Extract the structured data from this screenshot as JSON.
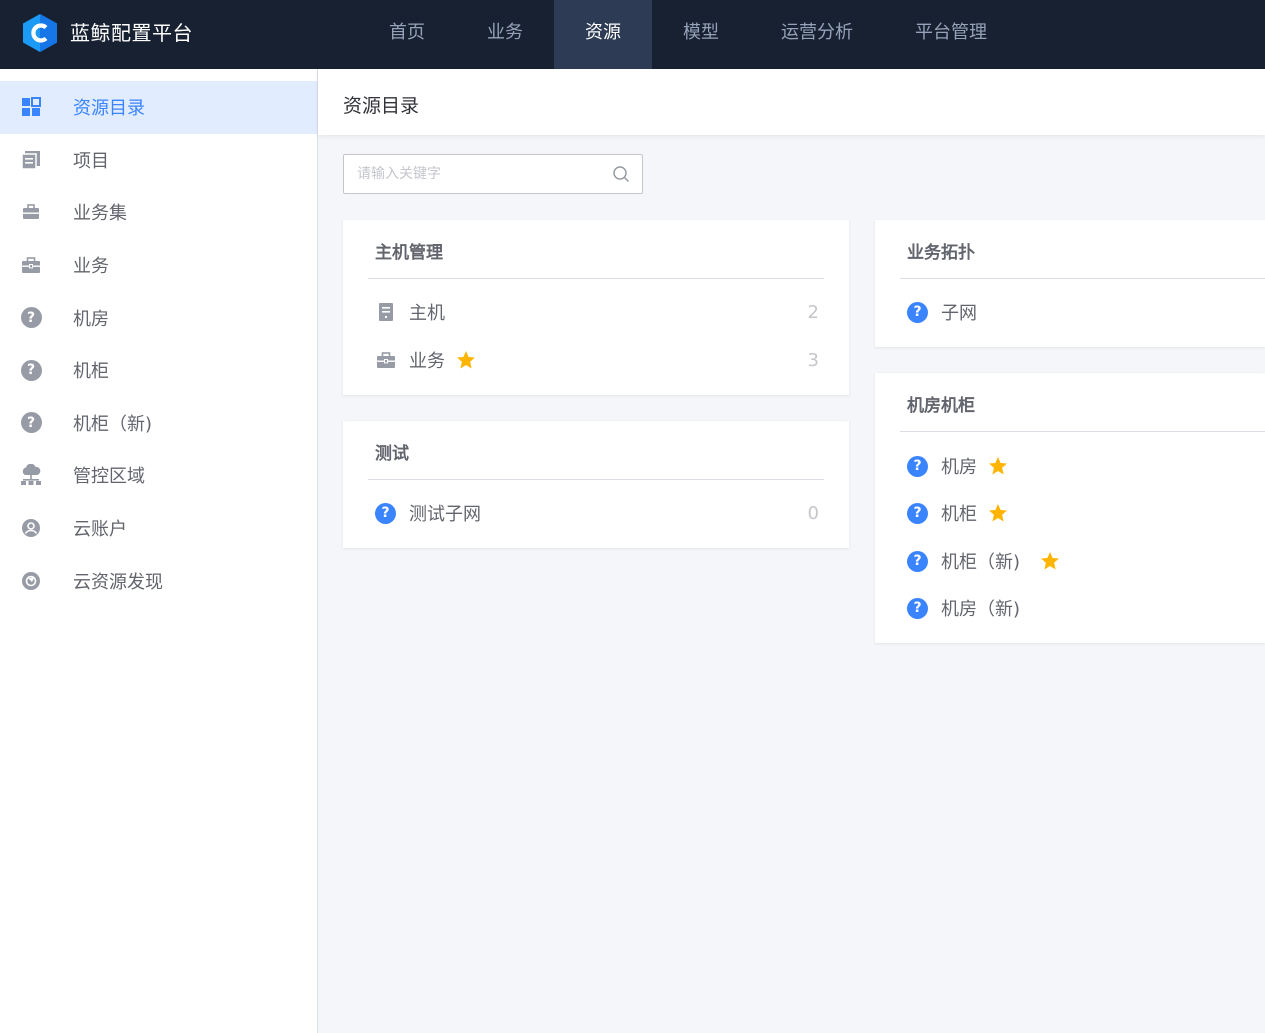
{
  "header": {
    "brand": "蓝鲸配置平台",
    "nav": [
      {
        "label": "首页",
        "active": false
      },
      {
        "label": "业务",
        "active": false
      },
      {
        "label": "资源",
        "active": true
      },
      {
        "label": "模型",
        "active": false
      },
      {
        "label": "运营分析",
        "active": false
      },
      {
        "label": "平台管理",
        "active": false
      }
    ]
  },
  "sidebar": {
    "items": [
      {
        "label": "资源目录",
        "icon": "grid-icon",
        "active": true
      },
      {
        "label": "项目",
        "icon": "document-icon",
        "active": false
      },
      {
        "label": "业务集",
        "icon": "briefcase-icon",
        "active": false
      },
      {
        "label": "业务",
        "icon": "toolbox-icon",
        "active": false
      },
      {
        "label": "机房",
        "icon": "question-icon",
        "active": false
      },
      {
        "label": "机柜",
        "icon": "question-icon",
        "active": false
      },
      {
        "label": "机柜（新)",
        "icon": "question-icon",
        "active": false
      },
      {
        "label": "管控区域",
        "icon": "cloud-network-icon",
        "active": false
      },
      {
        "label": "云账户",
        "icon": "user-circle-icon",
        "active": false
      },
      {
        "label": "云资源发现",
        "icon": "compass-icon",
        "active": false
      }
    ]
  },
  "main": {
    "title": "资源目录",
    "search": {
      "placeholder": "请输入关键字",
      "value": ""
    }
  },
  "cards": {
    "host_mgmt": {
      "title": "主机管理",
      "items": [
        {
          "label": "主机",
          "icon": "server-icon",
          "count": "2",
          "starred": false
        },
        {
          "label": "业务",
          "icon": "toolbox-icon",
          "count": "3",
          "starred": true
        }
      ]
    },
    "test": {
      "title": "测试",
      "items": [
        {
          "label": "测试子网",
          "icon": "question-icon",
          "count": "0",
          "starred": false
        }
      ]
    },
    "biz_topo": {
      "title": "业务拓扑",
      "items": [
        {
          "label": "子网",
          "icon": "question-icon",
          "starred": false
        }
      ]
    },
    "room_rack": {
      "title": "机房机柜",
      "items": [
        {
          "label": "机房",
          "icon": "question-icon",
          "starred": true
        },
        {
          "label": "机柜",
          "icon": "question-icon",
          "starred": true
        },
        {
          "label": "机柜（新)",
          "icon": "question-icon",
          "starred": true
        },
        {
          "label": "机房（新)",
          "icon": "question-icon",
          "starred": false
        }
      ]
    }
  },
  "colors": {
    "topbar": "#182132",
    "nav_active": "#2d3b55",
    "accent": "#3a84ff",
    "star": "#ffb400",
    "sidebar_active_bg": "#e1ecff"
  }
}
